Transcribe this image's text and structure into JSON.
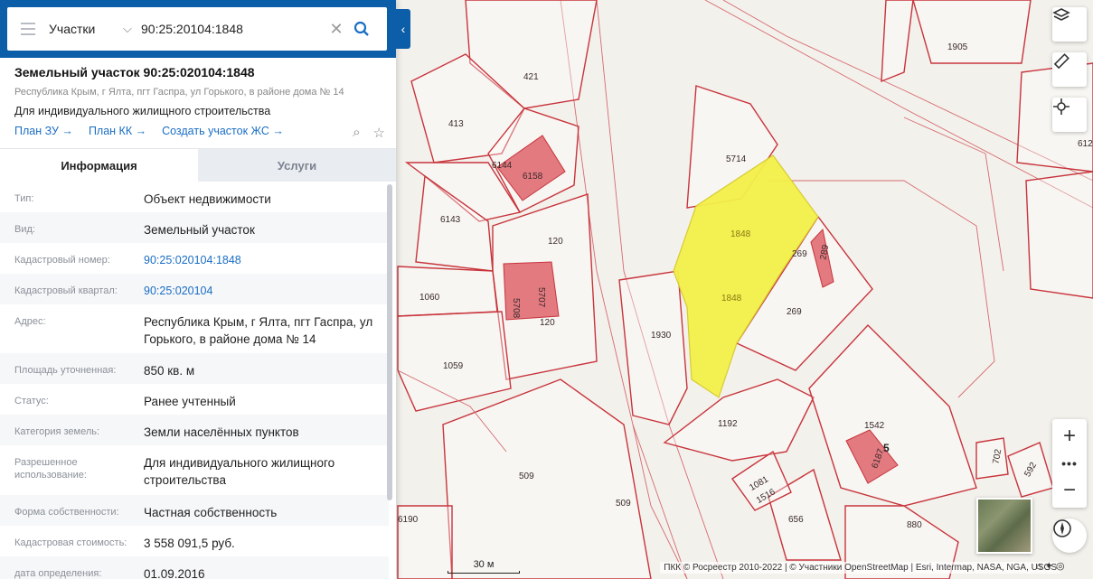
{
  "search": {
    "type": "Участки",
    "value": "90:25:20104:1848"
  },
  "object": {
    "title": "Земельный участок 90:25:020104:1848",
    "address": "Республика Крым, г Ялта, пгт Гаспра, ул Горького, в районе дома № 14",
    "use": "Для индивидуального жилищного строительства",
    "links": [
      "План ЗУ →",
      "План КК →",
      "Создать участок ЖС →"
    ]
  },
  "tabs": [
    "Информация",
    "Услуги"
  ],
  "info": [
    {
      "key": "Тип:",
      "value": "Объект недвижимости"
    },
    {
      "key": "Вид:",
      "value": "Земельный участок"
    },
    {
      "key": "Кадастровый номер:",
      "value": "90:25:020104:1848"
    },
    {
      "key": "Кадастровый квартал:",
      "value": "90:25:020104"
    },
    {
      "key": "Адрес:",
      "value": "Республика Крым, г Ялта, пгт Гаспра, ул Горького, в районе дома № 14"
    },
    {
      "key": "Площадь уточненная:",
      "value": "850 кв. м"
    },
    {
      "key": "Статус:",
      "value": "Ранее учтенный"
    },
    {
      "key": "Категория земель:",
      "value": "Земли населённых пунктов"
    },
    {
      "key": "Разрешенное использование:",
      "value": "Для индивидуального жилищного строительства"
    },
    {
      "key": "Форма собственности:",
      "value": "Частная собственность"
    },
    {
      "key": "Кадастровая стоимость:",
      "value": "3 558 091,5 руб."
    },
    {
      "key": "дата определения:",
      "value": "01.09.2016"
    }
  ],
  "map": {
    "plot_labels": [
      "421",
      "413",
      "1905",
      "6144",
      "6158",
      "6143",
      "120",
      "5714",
      "1848",
      "1848",
      "269",
      "269",
      "289",
      "1060",
      "5708",
      "5707",
      "120",
      "1930",
      "1059",
      "1192",
      "1542",
      "5",
      "6187",
      "702",
      "592",
      "509",
      "509",
      "1081",
      "1516",
      "656",
      "880",
      "6190",
      "612"
    ],
    "scale": "30 м",
    "attribution": "ПКК © Росреестр 2010-2022 | © Участники OpenStreetMap | Esri, Intermap, NASA, NGA, USGS",
    "colors": {
      "plot_border": "#c8343c",
      "selected": "#f4f04a",
      "building": "#e27a80"
    }
  }
}
